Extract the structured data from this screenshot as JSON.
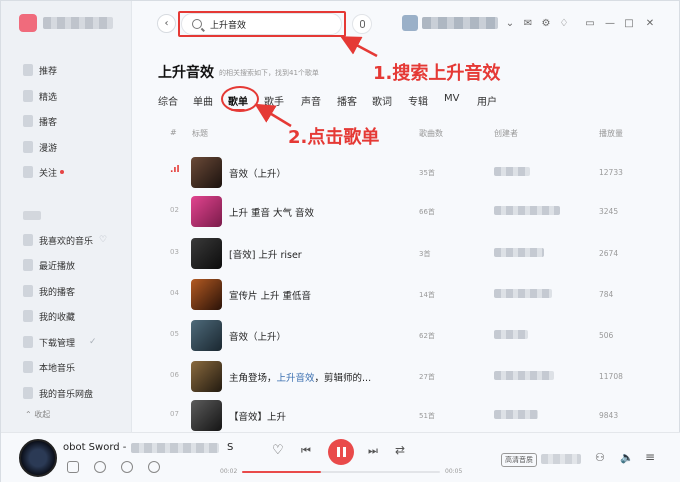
{
  "search": {
    "value": "上升音效"
  },
  "annotations": {
    "step1": "1.搜索上升音效",
    "step2": "2.点击歌单"
  },
  "sidebar": {
    "items": [
      {
        "label": "推荐"
      },
      {
        "label": "精选"
      },
      {
        "label": "播客"
      },
      {
        "label": "漫游"
      },
      {
        "label": "关注"
      },
      {
        "label": "我喜欢的音乐"
      },
      {
        "label": "最近播放"
      },
      {
        "label": "我的播客"
      },
      {
        "label": "我的收藏"
      },
      {
        "label": "下载管理"
      },
      {
        "label": "本地音乐"
      },
      {
        "label": "我的音乐网盘"
      }
    ],
    "collapse_label": "收起"
  },
  "header": {
    "title": "上升音效",
    "subtitle": "的相关搜索如下，找到41个歌单"
  },
  "tabs": [
    "综合",
    "单曲",
    "歌单",
    "歌手",
    "声音",
    "播客",
    "歌词",
    "专辑",
    "MV",
    "用户"
  ],
  "active_tab": "歌单",
  "table": {
    "columns": {
      "index": "#",
      "title": "标题",
      "count": "歌曲数",
      "creator": "创建者",
      "plays": "播放量"
    },
    "rows": [
      {
        "index": "",
        "title": "音效（上升）",
        "title_highlight": "",
        "title_suffix": "",
        "count": "35首",
        "plays": "12733",
        "cover": "#3a2a22"
      },
      {
        "index": "02",
        "title": "上升 重音 大气 音效",
        "title_highlight": "",
        "title_suffix": "",
        "count": "66首",
        "plays": "3245",
        "cover": "#c2357a"
      },
      {
        "index": "03",
        "title": "[音效] 上升 riser",
        "title_highlight": "",
        "title_suffix": "",
        "count": "3首",
        "plays": "2674",
        "cover": "#1c1c1c"
      },
      {
        "index": "04",
        "title": "宣传片 上升 重低音",
        "title_highlight": "",
        "title_suffix": "",
        "count": "14首",
        "plays": "784",
        "cover": "#5a2a14"
      },
      {
        "index": "05",
        "title": "音效（上升）",
        "title_highlight": "",
        "title_suffix": "",
        "count": "62首",
        "plays": "506",
        "cover": "#2b3f4e"
      },
      {
        "index": "06",
        "title": "主角登场，",
        "title_highlight": "上升音效",
        "title_suffix": "，剪辑师的...",
        "count": "27首",
        "plays": "11708",
        "cover": "#4a3b2a"
      },
      {
        "index": "07",
        "title": "【音效】上升",
        "title_highlight": "",
        "title_suffix": "",
        "count": "51首",
        "plays": "9843",
        "cover": "#3c3c3c"
      }
    ]
  },
  "player": {
    "title": "obot Sword - ",
    "title_tail": "S",
    "time_current": "00:02",
    "time_total": "00:05",
    "progress": 0.4,
    "quality": "高清音质"
  }
}
